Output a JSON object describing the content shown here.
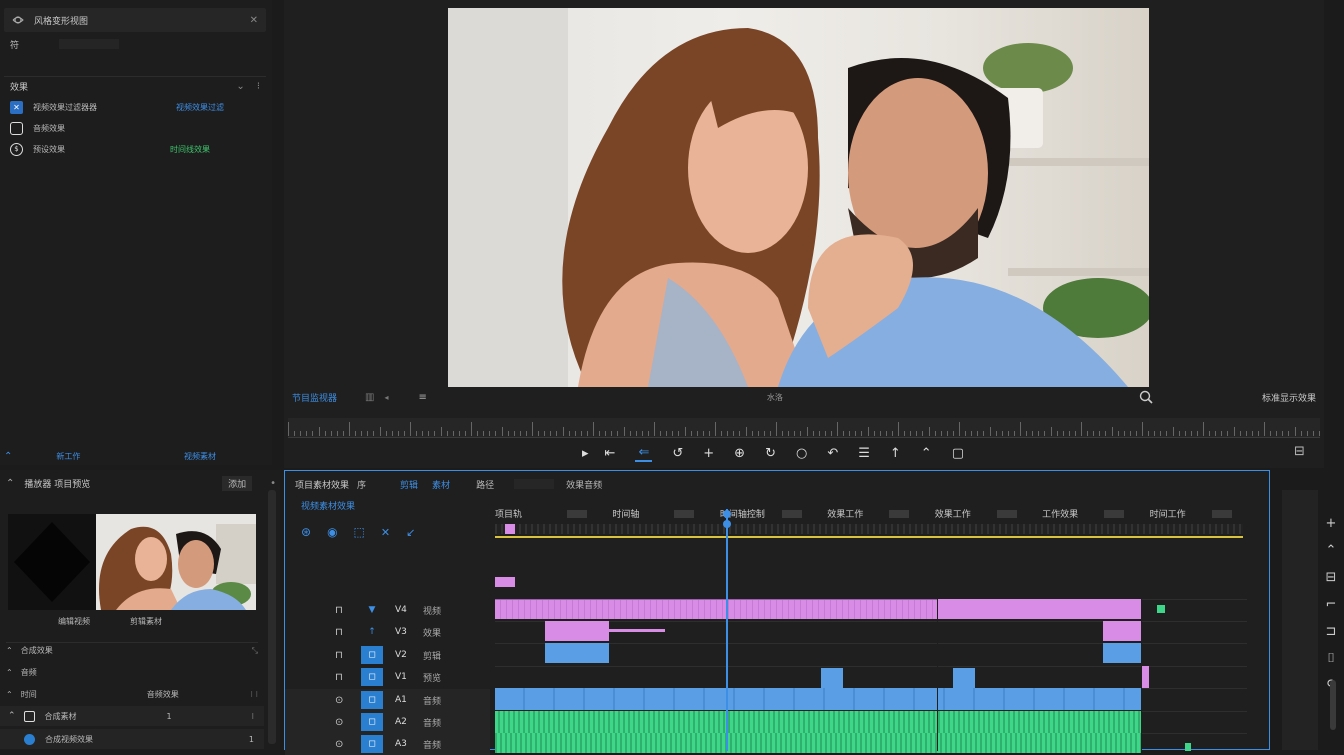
{
  "project_panel": {
    "header_label": "风格变形视图",
    "header_icon": "eye-icon",
    "sub_label": "符",
    "section_label": "效果",
    "items": [
      {
        "icon": "fx-icon",
        "label": "视频效果过滤器器",
        "value": "视频效果过滤",
        "value_color": "#3d8fe6"
      },
      {
        "icon": "square-icon",
        "label": "音频效果",
        "value": "",
        "value_color": "#3ec46b"
      },
      {
        "icon": "clock-icon",
        "label": "预设效果",
        "value": "时间线效果",
        "value_color": "#3ec46b"
      }
    ],
    "footer_left": "新工作",
    "footer_right": "视频素材"
  },
  "program_monitor": {
    "label": "节目监视器",
    "timecode": "水洛",
    "right_label": "标准显示效果",
    "magnifier_icon": "magnifier-icon",
    "bottom_right_icon": "export-frame-icon",
    "transport_buttons": [
      {
        "name": "play-icon",
        "glyph": "▸"
      },
      {
        "name": "mark-in-icon",
        "glyph": "⇤"
      },
      {
        "name": "step-back-icon",
        "glyph": "⇐",
        "active": true
      },
      {
        "name": "loop-icon",
        "glyph": "↺"
      },
      {
        "name": "plus-icon",
        "glyph": "+"
      },
      {
        "name": "lift-icon",
        "glyph": "⊕"
      },
      {
        "name": "insert-icon",
        "glyph": "↻"
      },
      {
        "name": "circle-icon",
        "glyph": "○"
      },
      {
        "name": "rotate-icon",
        "glyph": "↶"
      },
      {
        "name": "extract-icon",
        "glyph": "☰"
      },
      {
        "name": "mark-icon",
        "glyph": "↑"
      },
      {
        "name": "up-icon",
        "glyph": "⌃"
      },
      {
        "name": "frame-icon",
        "glyph": "▢"
      }
    ]
  },
  "source_panel": {
    "title": "播放器 项目预览",
    "tab_right": "添加",
    "thumb_left_label": "编辑视频",
    "thumb_right_label": "剪辑素材",
    "rows": [
      {
        "label": "合成效果",
        "value": ""
      },
      {
        "label": "音频",
        "value": ""
      },
      {
        "label": "时间",
        "value": "音频效果"
      },
      {
        "label": "合成素材",
        "value": "1"
      },
      {
        "label": "合成视频效果",
        "value": "1"
      }
    ]
  },
  "timeline": {
    "tab_label": "项目素材效果",
    "tab_2": "序",
    "tab_3": "剪辑",
    "tab_4": "素材",
    "tab_5": "路径",
    "tab_6": "效果音频",
    "toolbar_title": "视频素材效果",
    "markers": [
      "项目轨",
      "时间轴",
      "时间轴控制",
      "效果工作",
      "效果工作",
      "工作效果",
      "时间工作"
    ],
    "tracks": [
      {
        "name": "V4",
        "label": "视频"
      },
      {
        "name": "V3",
        "label": "效果"
      },
      {
        "name": "V2",
        "label": "剪辑"
      },
      {
        "name": "V1",
        "label": "预览"
      },
      {
        "name": "A1",
        "label": "音频"
      },
      {
        "name": "A2",
        "label": "音频"
      },
      {
        "name": "A3",
        "label": "音频"
      }
    ],
    "colors": {
      "video": "#d98ce6",
      "video_border": "#9c5fb0",
      "blue": "#5a9ee6",
      "audio": "#3ed688",
      "playhead": "#3d8fe6",
      "work": "#d9c23d"
    }
  },
  "right_toolbar": {
    "icons": [
      "plus-icon",
      "chevron-up-icon",
      "track-icon",
      "razor-icon",
      "ripple-icon",
      "slip-icon",
      "hand-icon"
    ]
  }
}
